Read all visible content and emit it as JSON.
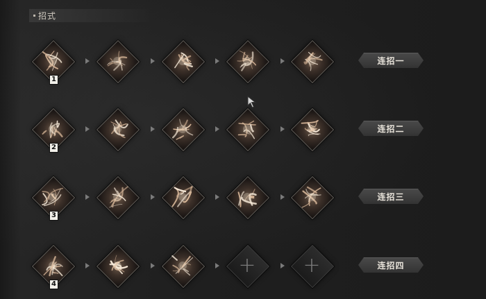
{
  "header": {
    "title": "招式"
  },
  "combos": [
    {
      "number": "1",
      "label": "连招一",
      "skills": [
        {
          "name": "lightning-strike-icon",
          "empty": false
        },
        {
          "name": "burst-slash-icon",
          "empty": false
        },
        {
          "name": "spear-thrust-icon",
          "empty": false
        },
        {
          "name": "rising-slash-icon",
          "empty": false
        },
        {
          "name": "claw-swipe-icon",
          "empty": false
        }
      ]
    },
    {
      "number": "2",
      "label": "连招二",
      "skills": [
        {
          "name": "ground-crack-icon",
          "empty": false
        },
        {
          "name": "scatter-strike-icon",
          "empty": false
        },
        {
          "name": "lunge-thrust-icon",
          "empty": false
        },
        {
          "name": "fire-burst-icon",
          "empty": false
        },
        {
          "name": "flame-wave-icon",
          "empty": false
        }
      ]
    },
    {
      "number": "3",
      "label": "连招三",
      "skills": [
        {
          "name": "spiral-vortex-icon",
          "empty": false
        },
        {
          "name": "sweeping-blow-icon",
          "empty": false
        },
        {
          "name": "crescent-slash-icon",
          "empty": false
        },
        {
          "name": "whirlwind-slash-icon",
          "empty": false
        },
        {
          "name": "cyclone-spin-icon",
          "empty": false
        }
      ]
    },
    {
      "number": "4",
      "label": "连招四",
      "skills": [
        {
          "name": "axe-smash-icon",
          "empty": false
        },
        {
          "name": "blade-strike-icon",
          "empty": false
        },
        {
          "name": "triple-spike-icon",
          "empty": false
        },
        {
          "name": "add-skill-icon",
          "empty": true
        },
        {
          "name": "add-skill-icon",
          "empty": true
        }
      ]
    }
  ],
  "colors": {
    "background": "#1e1e1e",
    "diamond_border": "#5e5a55",
    "button_text": "#e8e3da",
    "arrow": "#7b7b7b"
  }
}
